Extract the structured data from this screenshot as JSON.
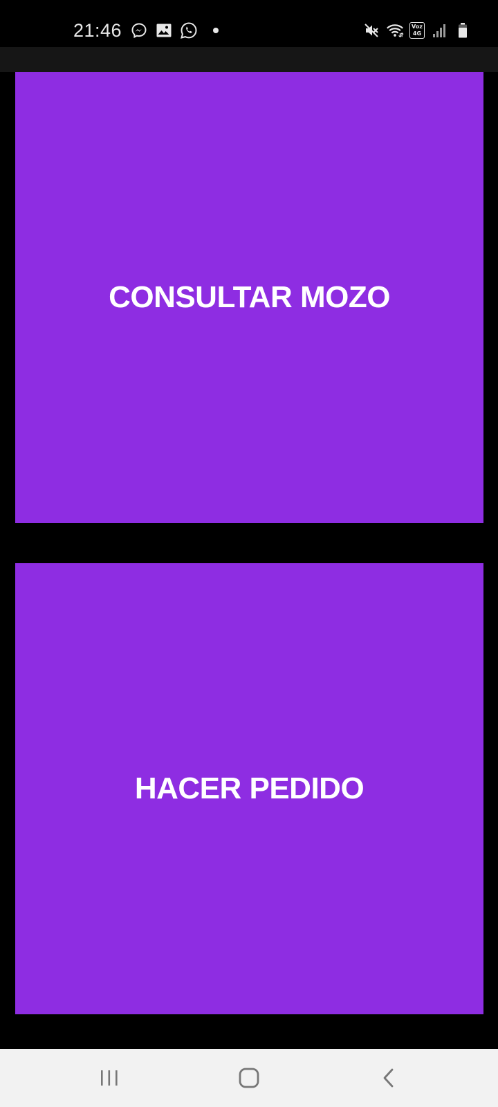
{
  "status_bar": {
    "time": "21:46",
    "notification_icons": [
      "messenger-icon",
      "gallery-icon",
      "whatsapp-icon",
      "more-notifications-dot"
    ],
    "system_icons": [
      "mute-icon",
      "wifi-icon",
      "volte-icon",
      "signal-icon",
      "battery-icon"
    ],
    "volte_label_top": "Voz",
    "volte_label_bottom": "4G"
  },
  "main": {
    "buttons": [
      {
        "label": "CONSULTAR MOZO"
      },
      {
        "label": "HACER PEDIDO"
      }
    ]
  },
  "colors": {
    "background": "#000000",
    "app_bar": "#161616",
    "button": "#8e2de2",
    "button_text": "#ffffff",
    "nav_bar": "#f2f2f2",
    "nav_icon": "#777777"
  },
  "nav_bar": {
    "icons": [
      "recent-apps-icon",
      "home-icon",
      "back-icon"
    ]
  }
}
